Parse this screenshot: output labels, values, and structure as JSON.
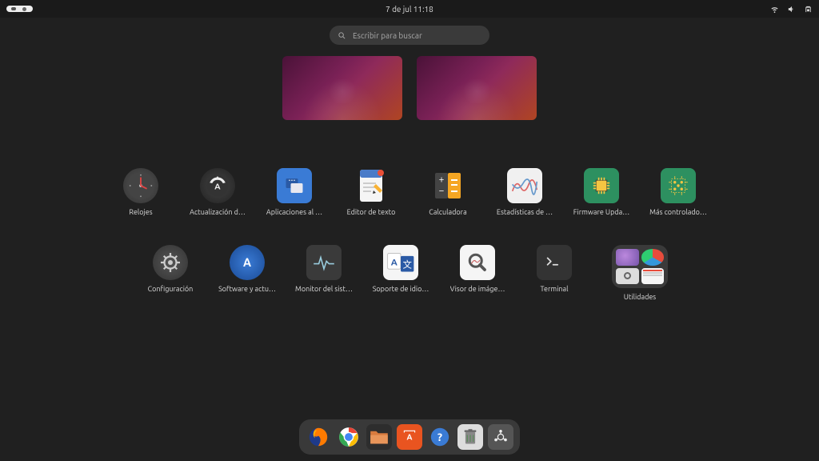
{
  "topbar": {
    "clock": "7 de jul  11:18"
  },
  "search": {
    "placeholder": "Escribir para buscar"
  },
  "apps": {
    "row1": [
      {
        "name": "clocks",
        "label": "Relojes"
      },
      {
        "name": "software-updater",
        "label": "Actualización d…"
      },
      {
        "name": "startup-apps",
        "label": "Aplicaciones al …"
      },
      {
        "name": "text-editor",
        "label": "Editor de texto"
      },
      {
        "name": "calculator",
        "label": "Calculadora"
      },
      {
        "name": "power-stats",
        "label": "Estadísticas de …"
      },
      {
        "name": "firmware-updater",
        "label": "Firmware Upda…"
      },
      {
        "name": "additional-drivers",
        "label": "Más controlado…"
      }
    ],
    "row2": [
      {
        "name": "settings",
        "label": "Configuración"
      },
      {
        "name": "software-sources",
        "label": "Software y actu…"
      },
      {
        "name": "system-monitor",
        "label": "Monitor del sist…"
      },
      {
        "name": "language-support",
        "label": "Soporte de idio…"
      },
      {
        "name": "image-viewer",
        "label": "Visor de imáge…"
      },
      {
        "name": "terminal",
        "label": "Terminal"
      },
      {
        "name": "utilities-folder",
        "label": "Utilidades"
      }
    ]
  },
  "dock": [
    {
      "name": "firefox"
    },
    {
      "name": "chrome"
    },
    {
      "name": "files"
    },
    {
      "name": "software-store"
    },
    {
      "name": "help"
    },
    {
      "name": "trash"
    },
    {
      "name": "show-apps"
    }
  ]
}
